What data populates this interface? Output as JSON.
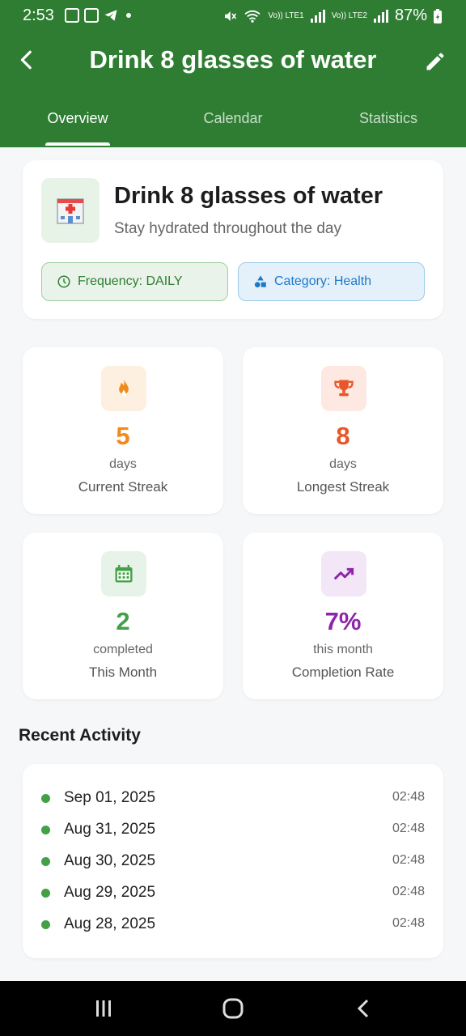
{
  "status_bar": {
    "time": "2:53",
    "network_1": "Vo)) LTE1",
    "network_2": "Vo)) LTE2",
    "battery": "87%"
  },
  "app_bar": {
    "title": "Drink 8 glasses of water",
    "back_icon": "arrow-back-icon",
    "edit_icon": "pencil-icon"
  },
  "tabs": [
    {
      "label": "Overview",
      "active": true
    },
    {
      "label": "Calendar",
      "active": false
    },
    {
      "label": "Statistics",
      "active": false
    }
  ],
  "habit": {
    "title": "Drink 8 glasses of water",
    "subtitle": "Stay hydrated throughout the day",
    "icon": "hospital-icon",
    "frequency_chip": "Frequency: DAILY",
    "category_chip": "Category: Health"
  },
  "stats": [
    {
      "value": "5",
      "unit": "days",
      "label": "Current Streak",
      "icon": "fire-icon",
      "color": "#f08a1c",
      "bg": "#fdf0e1"
    },
    {
      "value": "8",
      "unit": "days",
      "label": "Longest Streak",
      "icon": "trophy-icon",
      "color": "#e8572a",
      "bg": "#fde9e2"
    },
    {
      "value": "2",
      "unit": "completed",
      "label": "This Month",
      "icon": "calendar-icon",
      "color": "#43a047",
      "bg": "#e7f3e8"
    },
    {
      "value": "7%",
      "unit": "this month",
      "label": "Completion Rate",
      "icon": "trending-up-icon",
      "color": "#8e24aa",
      "bg": "#f3e6f6"
    }
  ],
  "recent_activity": {
    "title": "Recent Activity",
    "items": [
      {
        "date": "Sep 01, 2025",
        "time": "02:48"
      },
      {
        "date": "Aug 31, 2025",
        "time": "02:48"
      },
      {
        "date": "Aug 30, 2025",
        "time": "02:48"
      },
      {
        "date": "Aug 29, 2025",
        "time": "02:48"
      },
      {
        "date": "Aug 28, 2025",
        "time": "02:48"
      }
    ]
  },
  "colors": {
    "primary": "#2e7d32",
    "background": "#f6f7f9",
    "activity_dot": "#43a047"
  }
}
